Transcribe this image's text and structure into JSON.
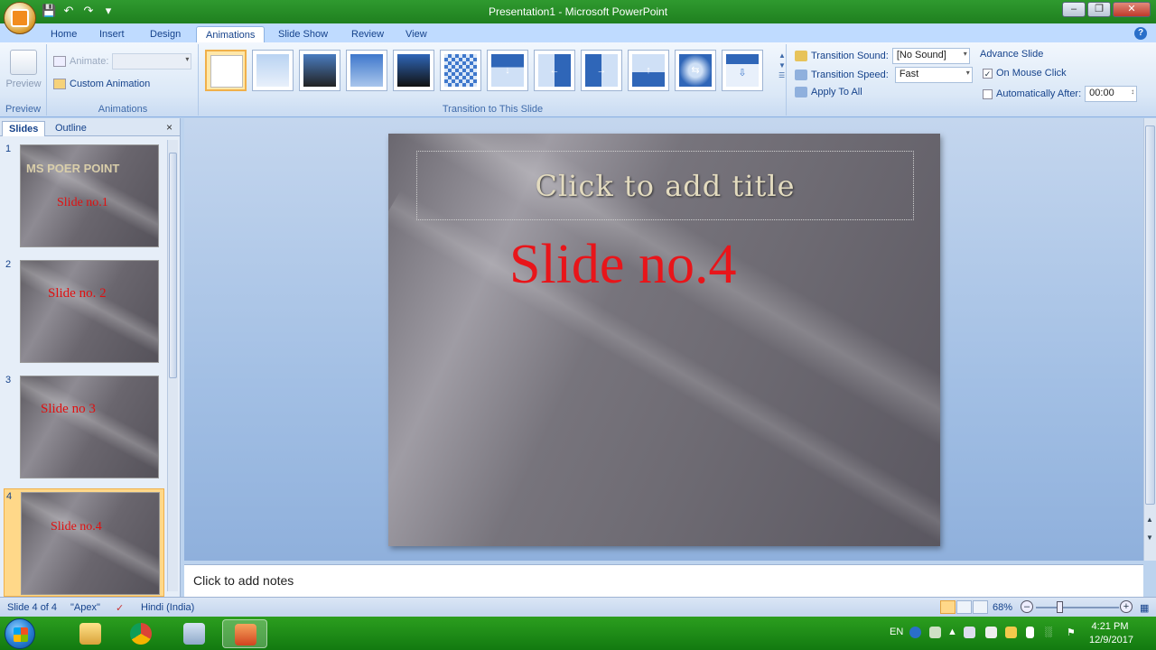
{
  "window": {
    "title": "Presentation1 - Microsoft PowerPoint"
  },
  "ribbon_tabs": [
    "Home",
    "Insert",
    "Design",
    "Animations",
    "Slide Show",
    "Review",
    "View"
  ],
  "ribbon": {
    "preview_label": "Preview",
    "preview_group": "Preview",
    "animate_label": "Animate:",
    "custom_animation_label": "Custom Animation",
    "animations_group": "Animations",
    "transition_group": "Transition to This Slide",
    "transition_sound_label": "Transition Sound:",
    "transition_sound_value": "[No Sound]",
    "transition_speed_label": "Transition Speed:",
    "transition_speed_value": "Fast",
    "apply_to_all_label": "Apply To All",
    "advance_slide_label": "Advance Slide",
    "on_mouse_click_label": "On Mouse Click",
    "on_mouse_click_checked": true,
    "auto_after_label": "Automatically After:",
    "auto_after_value": "00:00",
    "auto_after_checked": false
  },
  "slides_panel": {
    "tab_slides": "Slides",
    "tab_outline": "Outline",
    "slides": [
      {
        "num": "1",
        "header": "MS POER POINT",
        "text": "Slide no.1"
      },
      {
        "num": "2",
        "header": "",
        "text": "Slide no. 2"
      },
      {
        "num": "3",
        "header": "",
        "text": "Slide no 3"
      },
      {
        "num": "4",
        "header": "",
        "text": "Slide no.4"
      }
    ],
    "selected_index": 3
  },
  "current_slide": {
    "title_placeholder": "Click to add title",
    "body_text": "Slide no.4"
  },
  "notes_placeholder": "Click to add notes",
  "statusbar": {
    "slide_info": "Slide 4 of 4",
    "theme": "\"Apex\"",
    "language": "Hindi (India)",
    "zoom": "68%"
  },
  "taskbar": {
    "language": "EN",
    "time": "4:21 PM",
    "date": "12/9/2017"
  },
  "colors": {
    "slide_text_red": "#e8151a",
    "ribbon_blue": "#15428b",
    "taskbar_green": "#1f8a18"
  }
}
